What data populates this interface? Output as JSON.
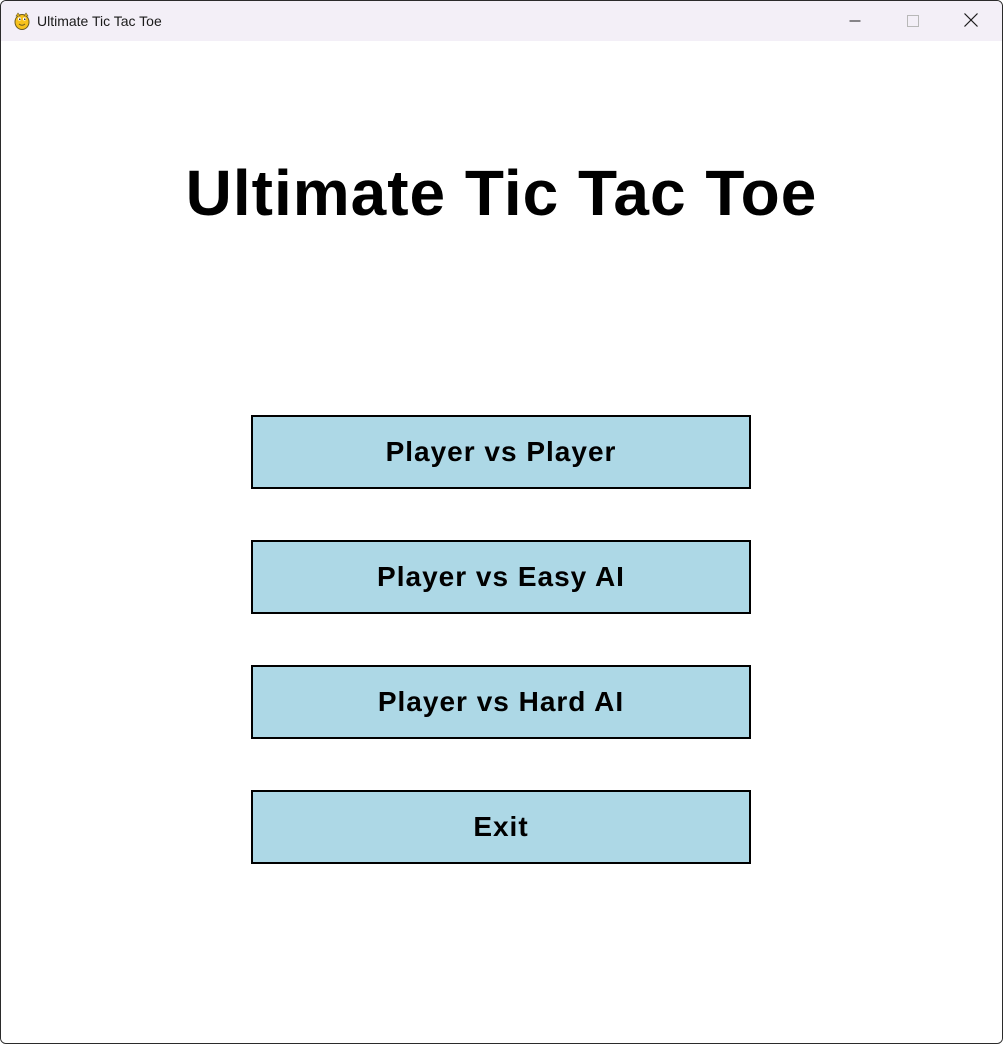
{
  "window": {
    "title": "Ultimate Tic Tac Toe",
    "app_icon": "python-snake-icon",
    "controls": {
      "minimize_icon": "minimize-icon",
      "maximize_icon": "maximize-icon",
      "close_icon": "close-icon"
    },
    "titlebar_color": "#f3eff7"
  },
  "menu": {
    "title": "Ultimate Tic Tac Toe",
    "buttons": [
      {
        "label": "Player vs Player"
      },
      {
        "label": "Player vs Easy AI"
      },
      {
        "label": "Player vs Hard AI"
      },
      {
        "label": "Exit"
      }
    ],
    "button_color": "#add8e6",
    "button_border_color": "#000000",
    "background_color": "#ffffff"
  }
}
